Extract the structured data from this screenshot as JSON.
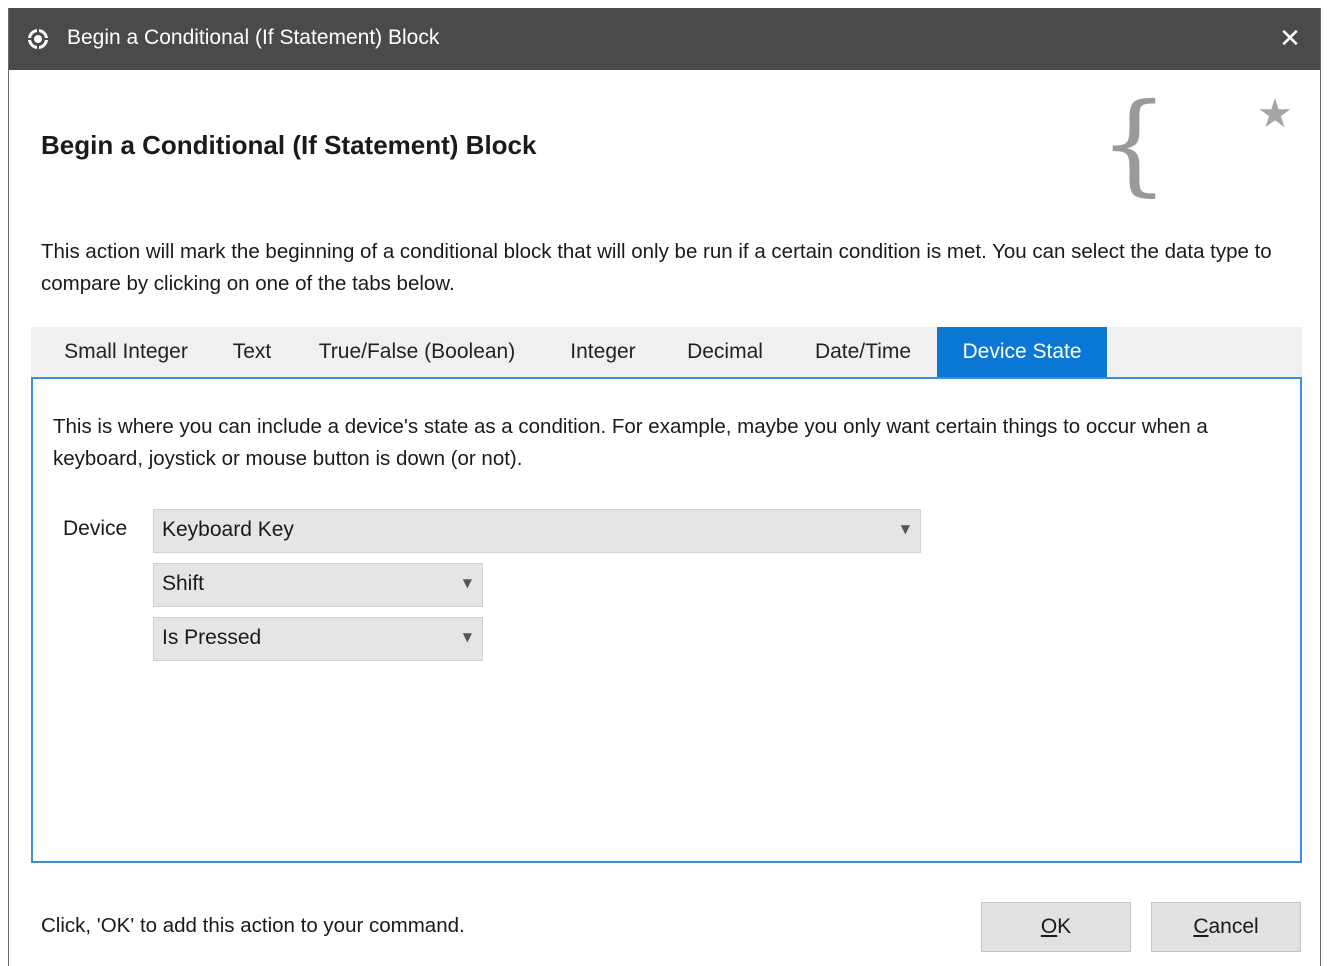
{
  "window": {
    "title": "Begin a Conditional (If Statement) Block",
    "close_glyph": "✕",
    "app_icon": "app-gear-icon"
  },
  "header": {
    "heading": "Begin a Conditional (If Statement) Block",
    "brace_glyph": "{",
    "star_glyph": "★"
  },
  "description": "This action will mark the beginning of a conditional block that will only be run if a certain condition is met.  You can select the data type to compare by clicking on one of the tabs below.",
  "tabs": [
    {
      "label": "Small Integer"
    },
    {
      "label": "Text"
    },
    {
      "label": "True/False (Boolean)"
    },
    {
      "label": "Integer"
    },
    {
      "label": "Decimal"
    },
    {
      "label": "Date/Time"
    },
    {
      "label": "Device State"
    }
  ],
  "active_tab": "Device State",
  "panel": {
    "description": "This is where you can include a device's state as a condition.  For example, maybe you only want certain things to occur when a keyboard, joystick or mouse button is down (or not).",
    "device_label": "Device",
    "device_value": "Keyboard Key",
    "key_value": "Shift",
    "state_value": "Is Pressed",
    "dropdown_glyph": "▼"
  },
  "footer": {
    "hint": "Click, 'OK' to add this action to your command.",
    "ok_mnemonic": "O",
    "ok_rest": "K",
    "cancel_mnemonic": "C",
    "cancel_rest": "ancel"
  },
  "colors": {
    "titlebar": "#4a4a4a",
    "accent": "#0a78d4",
    "panel_border": "#3b8fd9"
  }
}
